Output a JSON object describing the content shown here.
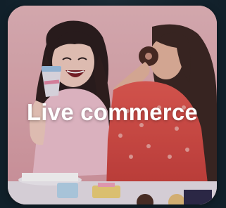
{
  "card": {
    "title": "Live commerce",
    "photo_subject": "two-women-eating-desserts-photo"
  },
  "colors": {
    "page_background": "#13212b",
    "title_text": "#ffffff",
    "photo_backdrop": "#e3b2b8"
  }
}
